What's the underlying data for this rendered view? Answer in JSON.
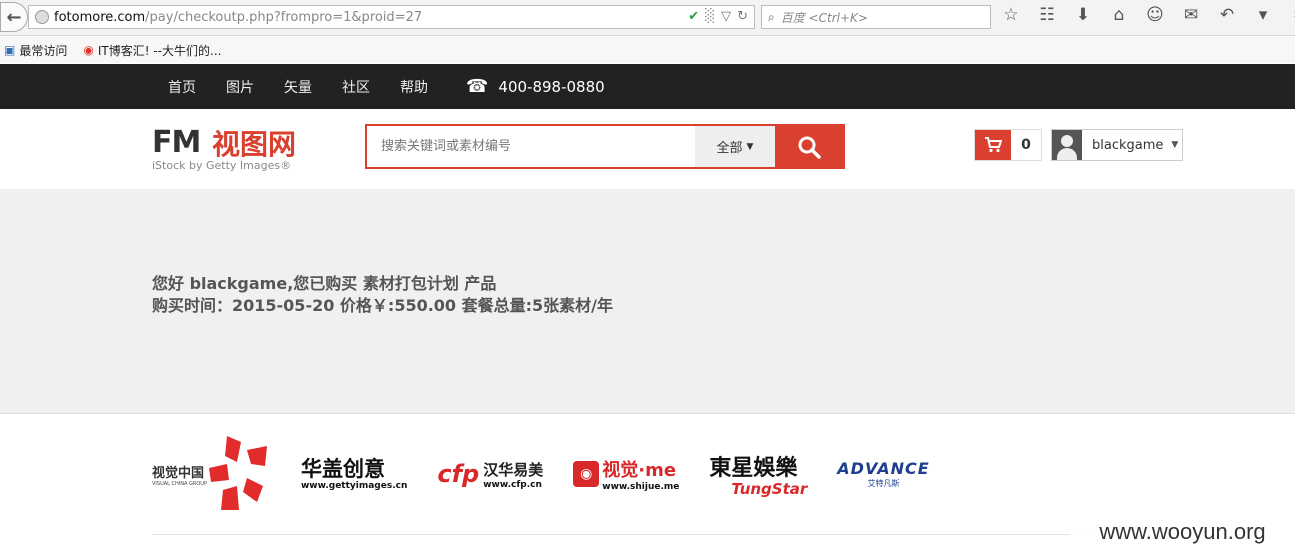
{
  "browser": {
    "url_host": "fotomore.com",
    "url_path": "/pay/checkoutp.php?frompro=1&proid=27",
    "search_placeholder": "百度 <Ctrl+K>"
  },
  "bookmarks": [
    {
      "label": "最常访问"
    },
    {
      "label": "IT博客汇! --大牛们的..."
    }
  ],
  "nav": {
    "items": [
      "首页",
      "图片",
      "矢量",
      "社区",
      "帮助"
    ],
    "phone": "400-898-0880"
  },
  "header": {
    "logo_fm": "FM",
    "logo_cn": "视图网",
    "logo_sub": "iStock by Getty Images®",
    "search_placeholder": "搜索关键词或素材编号",
    "scope": "全部",
    "cart_count": "0",
    "username": "blackgame"
  },
  "message": {
    "line1": "您好 blackgame,您已购买  素材打包计划  产品",
    "line2": "购买时间：2015-05-20   价格￥:550.00   套餐总量:5张素材/年"
  },
  "partners": {
    "vcg_cn": "视觉中国",
    "vcg_en": "VISUAL CHINA GROUP",
    "getty_cn": "华盖创意",
    "getty_url": "www.gettyimages.cn",
    "cfp_cn": "汉华易美",
    "cfp_url": "www.cfp.cn",
    "shijue_cn": "视觉·me",
    "shijue_url": "www.shijue.me",
    "tung_cn": "東星娛樂",
    "tung_en": "TungStar",
    "adv_en": "ADVANCE",
    "adv_cn": "艾特凡斯"
  },
  "watermark": "www.wooyun.org"
}
